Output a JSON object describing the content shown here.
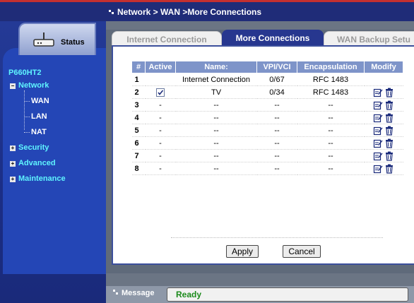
{
  "breadcrumb": "Network > WAN >More Connections",
  "device": "P660HT2",
  "status_label": "Status",
  "nav": {
    "network": "Network",
    "sub": [
      "WAN",
      "LAN",
      "NAT"
    ],
    "security": "Security",
    "advanced": "Advanced",
    "maintenance": "Maintenance"
  },
  "tabs": [
    "Internet Connection",
    "More Connections",
    "WAN Backup Setu"
  ],
  "table": {
    "headers": [
      "#",
      "Active",
      "Name:",
      "VPI/VCI",
      "Encapsulation",
      "Modify"
    ],
    "rows": [
      {
        "num": "1",
        "active": "",
        "name": "Internet Connection",
        "vpivci": "0/67",
        "encap": "RFC 1483"
      },
      {
        "num": "2",
        "active": "checked",
        "name": "TV",
        "vpivci": "0/34",
        "encap": "RFC 1483"
      },
      {
        "num": "3",
        "active": "-",
        "name": "--",
        "vpivci": "--",
        "encap": "--"
      },
      {
        "num": "4",
        "active": "-",
        "name": "--",
        "vpivci": "--",
        "encap": "--"
      },
      {
        "num": "5",
        "active": "-",
        "name": "--",
        "vpivci": "--",
        "encap": "--"
      },
      {
        "num": "6",
        "active": "-",
        "name": "--",
        "vpivci": "--",
        "encap": "--"
      },
      {
        "num": "7",
        "active": "-",
        "name": "--",
        "vpivci": "--",
        "encap": "--"
      },
      {
        "num": "8",
        "active": "-",
        "name": "--",
        "vpivci": "--",
        "encap": "--"
      }
    ]
  },
  "buttons": {
    "apply": "Apply",
    "cancel": "Cancel"
  },
  "message": {
    "label": "Message",
    "value": "Ready"
  },
  "colors": {
    "accent": "#27378f",
    "header": "#7e94c9",
    "nav_text": "#5ff5ff",
    "ready": "#1b8a1b"
  }
}
